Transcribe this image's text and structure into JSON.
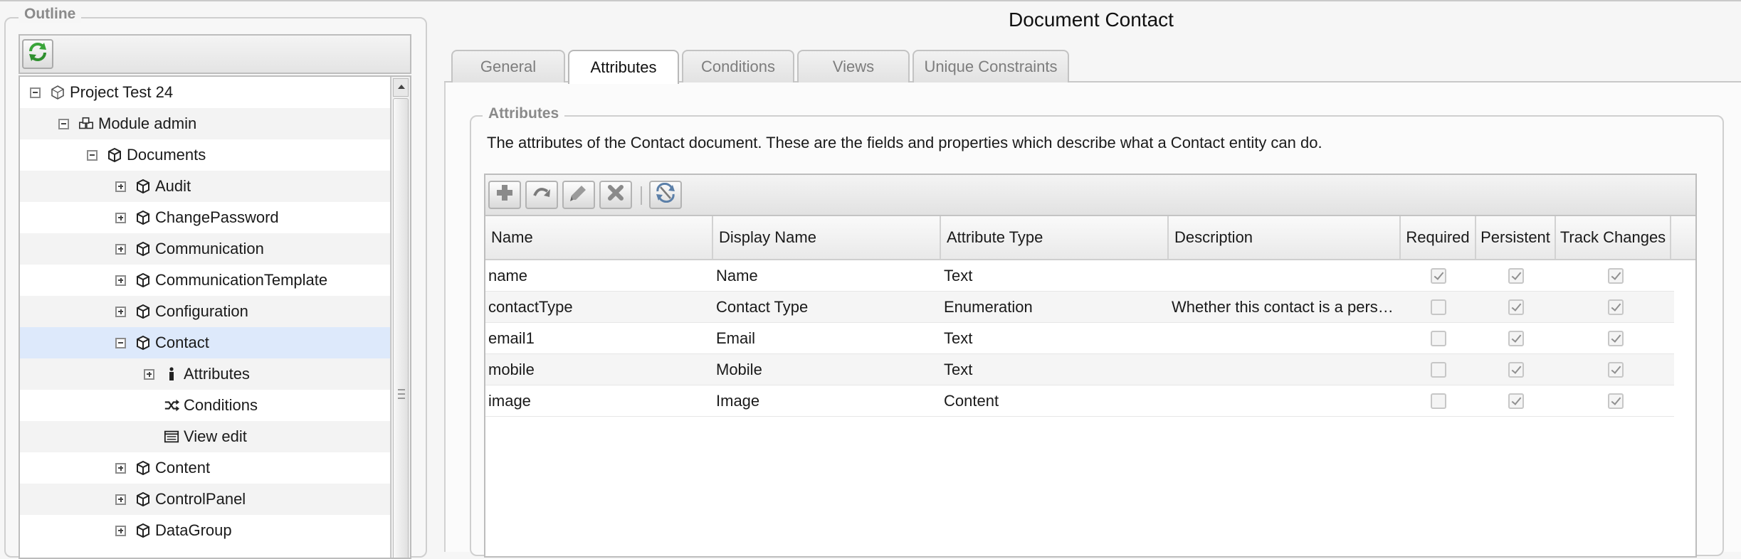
{
  "outline": {
    "legend": "Outline",
    "tree": [
      {
        "label": "Project Test 24",
        "icon": "project-icon",
        "level": 0,
        "expander": "minus"
      },
      {
        "label": "Module admin",
        "icon": "module-icon",
        "level": 1,
        "expander": "minus"
      },
      {
        "label": "Documents",
        "icon": "document-icon",
        "level": 2,
        "expander": "minus"
      },
      {
        "label": "Audit",
        "icon": "document-icon",
        "level": 3,
        "expander": "plus"
      },
      {
        "label": "ChangePassword",
        "icon": "document-icon",
        "level": 3,
        "expander": "plus"
      },
      {
        "label": "Communication",
        "icon": "document-icon",
        "level": 3,
        "expander": "plus"
      },
      {
        "label": "CommunicationTemplate",
        "icon": "document-icon",
        "level": 3,
        "expander": "plus"
      },
      {
        "label": "Configuration",
        "icon": "document-icon",
        "level": 3,
        "expander": "plus"
      },
      {
        "label": "Contact",
        "icon": "document-icon",
        "level": 3,
        "expander": "minus",
        "selected": true
      },
      {
        "label": "Attributes",
        "icon": "info-icon",
        "level": 4,
        "expander": "plus"
      },
      {
        "label": "Conditions",
        "icon": "shuffle-icon",
        "level": 4,
        "expander": "none"
      },
      {
        "label": "View edit",
        "icon": "view-icon",
        "level": 4,
        "expander": "none"
      },
      {
        "label": "Content",
        "icon": "document-icon",
        "level": 3,
        "expander": "plus"
      },
      {
        "label": "ControlPanel",
        "icon": "document-icon",
        "level": 3,
        "expander": "plus"
      },
      {
        "label": "DataGroup",
        "icon": "document-icon",
        "level": 3,
        "expander": "plus"
      }
    ]
  },
  "main": {
    "title": "Document Contact",
    "tabs": [
      {
        "label": "General",
        "active": false
      },
      {
        "label": "Attributes",
        "active": true
      },
      {
        "label": "Conditions",
        "active": false
      },
      {
        "label": "Views",
        "active": false
      },
      {
        "label": "Unique Constraints",
        "active": false
      }
    ],
    "attributes": {
      "legend": "Attributes",
      "description": "The attributes of the Contact document. These are the fields and properties which describe what a Contact entity can do.",
      "toolbar_icons": [
        "add-icon",
        "redo-icon",
        "edit-icon",
        "delete-icon",
        "refresh-sync-icon"
      ],
      "columns": [
        "Name",
        "Display Name",
        "Attribute Type",
        "Description",
        "Required",
        "Persistent",
        "Track Changes"
      ],
      "rows": [
        {
          "name": "name",
          "display_name": "Name",
          "type": "Text",
          "description": "",
          "required": true,
          "persistent": true,
          "track_changes": true
        },
        {
          "name": "contactType",
          "display_name": "Contact Type",
          "type": "Enumeration",
          "description": "Whether this contact is a person or an organisation.",
          "required": false,
          "persistent": true,
          "track_changes": true
        },
        {
          "name": "email1",
          "display_name": "Email",
          "type": "Text",
          "description": "",
          "required": false,
          "persistent": true,
          "track_changes": true
        },
        {
          "name": "mobile",
          "display_name": "Mobile",
          "type": "Text",
          "description": "",
          "required": false,
          "persistent": true,
          "track_changes": true
        },
        {
          "name": "image",
          "display_name": "Image",
          "type": "Content",
          "description": "",
          "required": false,
          "persistent": true,
          "track_changes": true
        }
      ]
    }
  },
  "colors": {
    "selected_row": "#dde9fb",
    "refresh_green": "#3aa53a",
    "toolbar_icon_gray": "#8a8a8a"
  }
}
